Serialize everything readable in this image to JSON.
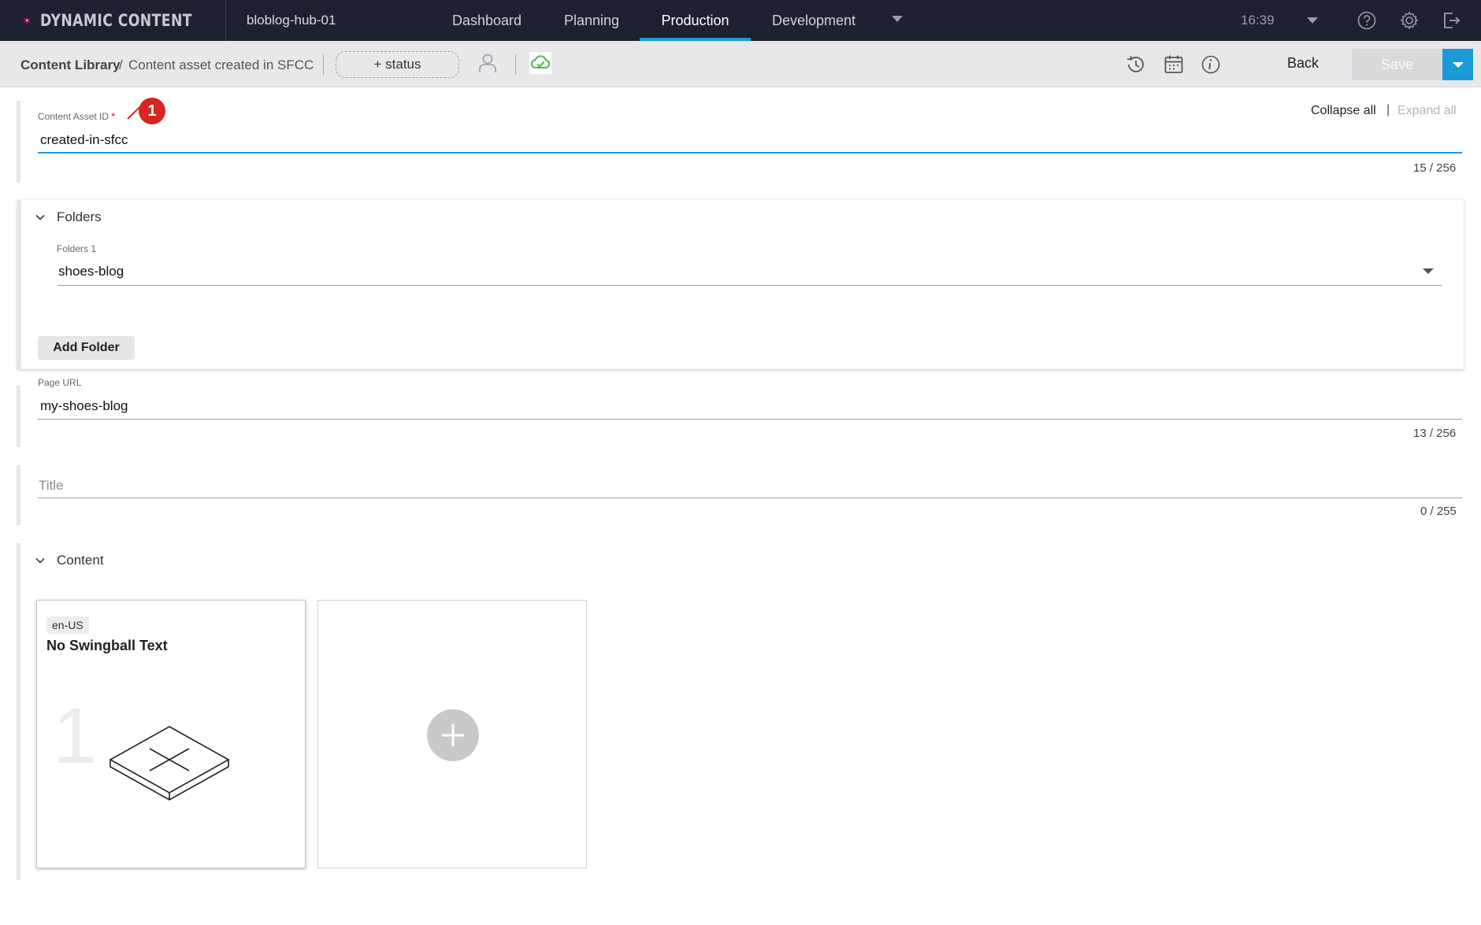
{
  "app": {
    "brand": "DYNAMIC CONTENT",
    "hub": "bloblog-hub-01",
    "nav": [
      {
        "label": "Dashboard",
        "active": false
      },
      {
        "label": "Planning",
        "active": false
      },
      {
        "label": "Production",
        "active": true
      },
      {
        "label": "Development",
        "active": false
      }
    ],
    "time": "16:39",
    "accent": "#1a9bd7"
  },
  "toolbar": {
    "breadcrumb_root": "Content Library",
    "breadcrumb_sep": "/",
    "breadcrumb_title": "Content asset created in SFCC",
    "status_label": "+ status",
    "back_label": "Back",
    "save_label": "Save"
  },
  "controls": {
    "collapse_all": "Collapse all",
    "separator": "|",
    "expand_all": "Expand all"
  },
  "annotation": {
    "number": "1"
  },
  "fields": {
    "asset_id": {
      "label": "Content Asset ID",
      "required_mark": "*",
      "value": "created-in-sfcc",
      "counter": "15 / 256"
    },
    "page_url": {
      "label": "Page URL",
      "value": "my-shoes-blog",
      "counter": "13 / 256"
    },
    "title": {
      "placeholder": "Title",
      "counter": "0 / 255"
    }
  },
  "folders": {
    "heading": "Folders",
    "item_label": "Folders 1",
    "item_value": "shoes-blog",
    "add_button": "Add Folder"
  },
  "content": {
    "heading": "Content",
    "cards": [
      {
        "locale": "en-US",
        "title": "No Swingball Text",
        "index": "1"
      }
    ]
  },
  "icons": [
    "logo-icon",
    "help-icon",
    "gear-icon",
    "logout-icon",
    "user-icon",
    "cloud-sync-icon",
    "history-icon",
    "calendar-icon",
    "info-icon",
    "chevron-down-icon",
    "plus-icon",
    "missing-visualization-icon"
  ]
}
